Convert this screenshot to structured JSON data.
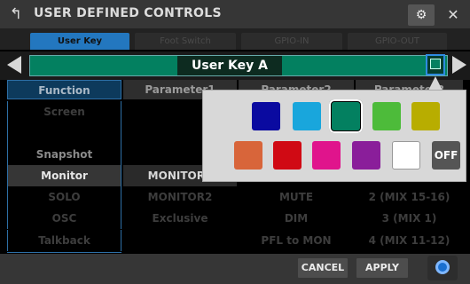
{
  "window": {
    "title": "USER DEFINED CONTROLS",
    "back_icon": "back-arrow-icon",
    "gear_icon": "gear-icon",
    "close_icon": "close-icon"
  },
  "tabs": [
    {
      "label": "User Key",
      "active": true
    },
    {
      "label": "Foot Switch",
      "active": false
    },
    {
      "label": "GPIO-IN",
      "active": false
    },
    {
      "label": "GPIO-OUT",
      "active": false
    }
  ],
  "selector": {
    "key_name": "User Key A",
    "color": "#038060"
  },
  "table": {
    "headers": [
      "Function",
      "Parameter1",
      "Parameter2",
      "Parameter3"
    ],
    "rows": [
      {
        "function": "Screen",
        "p1": "",
        "p2": "",
        "p3": ""
      },
      {
        "function": "",
        "p1": "",
        "p2": "",
        "p3": ""
      },
      {
        "function": "Snapshot",
        "p1": "",
        "p2": "",
        "p3": ""
      },
      {
        "function": "Monitor",
        "p1": "MONITOR1",
        "p2": "",
        "p3": ""
      },
      {
        "function": "SOLO",
        "p1": "MONITOR2",
        "p2": "MUTE",
        "p3": "2 (MIX 15-16)"
      },
      {
        "function": "OSC",
        "p1": "Exclusive",
        "p2": "DIM",
        "p3": "3 (MIX 1)"
      },
      {
        "function": "Talkback",
        "p1": "",
        "p2": "PFL to MON",
        "p3": "4 (MIX 11-12)"
      }
    ]
  },
  "footer": {
    "cancel_label": "CANCEL",
    "apply_label": "APPLY",
    "encoder_icon": "encoder-icon"
  },
  "palette": {
    "colors": [
      "#0a0aa0",
      "#19a6dc",
      "#038060",
      "#4dbb3a",
      "#b8ad00",
      "#d8653a",
      "#d00a14",
      "#e0148c",
      "#8a1e9a",
      "#ffffff"
    ],
    "selected_index": 2,
    "off_label": "OFF"
  }
}
